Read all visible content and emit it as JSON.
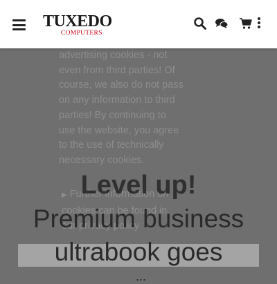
{
  "header": {
    "logo": {
      "main": "TUXEDO",
      "sub": "COMPUTERS"
    },
    "icons": [
      "menu-icon",
      "search-icon",
      "chat-icon",
      "cart-icon",
      "more-vertical-icon"
    ]
  },
  "cookie_notice": {
    "text": "advertising cookies - not even from third parties! Of course, we also do not pass on any information to third parties! By continuing to use the website, you agree to the use of technically necessary cookies.",
    "more": "Further information on cookies can be found in our privacy policy"
  },
  "hero": {
    "title": "Level up!",
    "subtitle_line1": "Premium business",
    "subtitle_line2": "ultrabook goes",
    "subtitle_line3": "..."
  },
  "colors": {
    "overlay": "#6f6f6f",
    "brand_red": "#d0021b"
  }
}
